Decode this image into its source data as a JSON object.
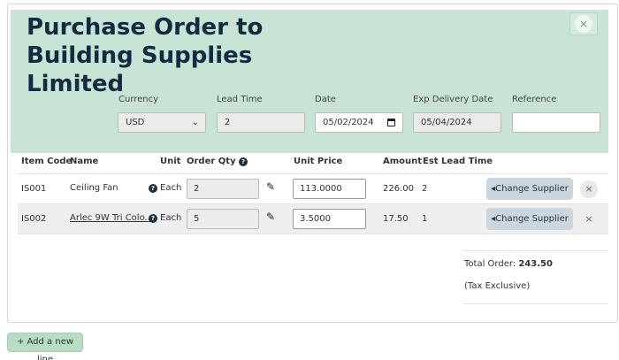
{
  "title": "Purchase Order to Building Supplies Limited",
  "close_symbol": "×",
  "fields": {
    "currency": {
      "label": "Currency",
      "value": "USD"
    },
    "lead_time": {
      "label": "Lead Time",
      "value": "2"
    },
    "date": {
      "label": "Date",
      "value": "05/02/2024"
    },
    "exp_delivery": {
      "label": "Exp Delivery Date",
      "value": "05/04/2024"
    },
    "reference": {
      "label": "Reference",
      "value": ""
    }
  },
  "columns": {
    "item_code": "Item Code",
    "name": "Name",
    "unit": "Unit",
    "order_qty": "Order Qty",
    "unit_price": "Unit Price",
    "amount": "Amount",
    "est_lead_time": "Est Lead Time"
  },
  "help_symbol": "?",
  "rows": [
    {
      "code": "IS001",
      "name": "Ceiling Fan",
      "unit": "Each",
      "qty": "2",
      "price": "113.0000",
      "amount": "226.00",
      "lead": "2",
      "change_label": "◂Change Supplier",
      "remove": "×"
    },
    {
      "code": "IS002",
      "name": "Arlec 9W Tri Colo...",
      "unit": "Each",
      "qty": "5",
      "price": "3.5000",
      "amount": "17.50",
      "lead": "1",
      "change_label": "◂Change Supplier",
      "remove": "×"
    }
  ],
  "totals": {
    "label": "Total Order:",
    "value": "243.50",
    "note": "(Tax Exclusive)"
  },
  "add_line_label": "+ Add a new line",
  "icons": {
    "pencil": "pencil-icon",
    "help": "help-icon",
    "close": "close-icon",
    "calendar": "calendar-icon",
    "chevron": "chevron-down-icon"
  },
  "colors": {
    "header_bg": "#c9e3d4",
    "title": "#0f2d40",
    "change_btn": "#cbd7e0",
    "add_btn": "#b8dcc6"
  }
}
